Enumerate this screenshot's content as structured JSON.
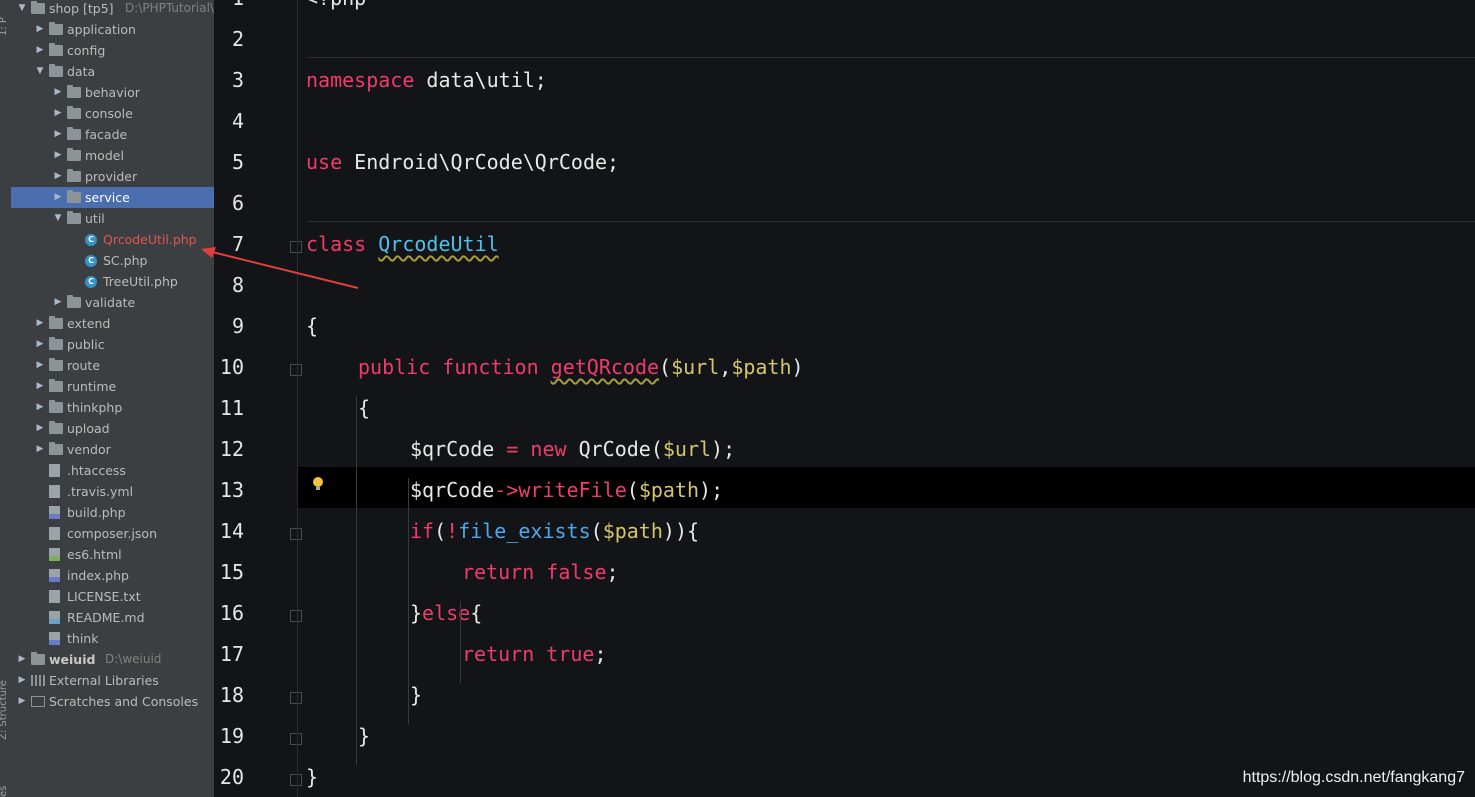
{
  "tool_strip": {
    "top_label": "1: P",
    "bottom_label": "Z: Structure",
    "bottom2_label": "es"
  },
  "tree": {
    "items": [
      {
        "label": "shop [tp5]",
        "hint": "D:\\PHPTutorial\\W",
        "indent": 0,
        "arrow": "down",
        "icon": "module"
      },
      {
        "label": "application",
        "indent": 1,
        "arrow": "right",
        "icon": "folder"
      },
      {
        "label": "config",
        "indent": 1,
        "arrow": "right",
        "icon": "folder"
      },
      {
        "label": "data",
        "indent": 1,
        "arrow": "down",
        "icon": "folder"
      },
      {
        "label": "behavior",
        "indent": 2,
        "arrow": "right",
        "icon": "folder"
      },
      {
        "label": "console",
        "indent": 2,
        "arrow": "right",
        "icon": "folder"
      },
      {
        "label": "facade",
        "indent": 2,
        "arrow": "right",
        "icon": "folder"
      },
      {
        "label": "model",
        "indent": 2,
        "arrow": "right",
        "icon": "folder"
      },
      {
        "label": "provider",
        "indent": 2,
        "arrow": "right",
        "icon": "folder"
      },
      {
        "label": "service",
        "indent": 2,
        "arrow": "right",
        "icon": "folder",
        "selected": true
      },
      {
        "label": "util",
        "indent": 2,
        "arrow": "down",
        "icon": "folder"
      },
      {
        "label": "QrcodeUtil.php",
        "indent": 3,
        "arrow": "",
        "icon": "class",
        "red": true
      },
      {
        "label": "SC.php",
        "indent": 3,
        "arrow": "",
        "icon": "class"
      },
      {
        "label": "TreeUtil.php",
        "indent": 3,
        "arrow": "",
        "icon": "class"
      },
      {
        "label": "validate",
        "indent": 2,
        "arrow": "right",
        "icon": "folder"
      },
      {
        "label": "extend",
        "indent": 1,
        "arrow": "right",
        "icon": "folder"
      },
      {
        "label": "public",
        "indent": 1,
        "arrow": "right",
        "icon": "folder"
      },
      {
        "label": "route",
        "indent": 1,
        "arrow": "right",
        "icon": "folder"
      },
      {
        "label": "runtime",
        "indent": 1,
        "arrow": "right",
        "icon": "folder"
      },
      {
        "label": "thinkphp",
        "indent": 1,
        "arrow": "right",
        "icon": "folder"
      },
      {
        "label": "upload",
        "indent": 1,
        "arrow": "right",
        "icon": "folder"
      },
      {
        "label": "vendor",
        "indent": 1,
        "arrow": "right",
        "icon": "folder"
      },
      {
        "label": ".htaccess",
        "indent": 1,
        "arrow": "",
        "icon": "file"
      },
      {
        "label": ".travis.yml",
        "indent": 1,
        "arrow": "",
        "icon": "file"
      },
      {
        "label": "build.php",
        "indent": 1,
        "arrow": "",
        "icon": "php"
      },
      {
        "label": "composer.json",
        "indent": 1,
        "arrow": "",
        "icon": "file"
      },
      {
        "label": "es6.html",
        "indent": 1,
        "arrow": "",
        "icon": "html"
      },
      {
        "label": "index.php",
        "indent": 1,
        "arrow": "",
        "icon": "php"
      },
      {
        "label": "LICENSE.txt",
        "indent": 1,
        "arrow": "",
        "icon": "file"
      },
      {
        "label": "README.md",
        "indent": 1,
        "arrow": "",
        "icon": "md"
      },
      {
        "label": "think",
        "indent": 1,
        "arrow": "",
        "icon": "php"
      },
      {
        "label": "weiuid",
        "hint": "D:\\weiuid",
        "indent": 0,
        "arrow": "right",
        "icon": "module",
        "bold": true
      },
      {
        "label": "External Libraries",
        "indent": 0,
        "arrow": "right",
        "icon": "lib"
      },
      {
        "label": "Scratches and Consoles",
        "indent": 0,
        "arrow": "right",
        "icon": "scratch"
      }
    ]
  },
  "editor": {
    "line_numbers": [
      "1",
      "2",
      "3",
      "4",
      "5",
      "6",
      "7",
      "8",
      "9",
      "10",
      "11",
      "12",
      "13",
      "14",
      "15",
      "16",
      "17",
      "18",
      "19",
      "20"
    ],
    "lines": [
      {
        "n": 1,
        "indent": 0,
        "tokens": [
          {
            "t": "<?php",
            "c": "txt"
          }
        ]
      },
      {
        "n": 2,
        "indent": 0,
        "tokens": []
      },
      {
        "n": 3,
        "indent": 0,
        "tokens": [
          {
            "t": "namespace",
            "c": "k"
          },
          {
            "t": " data\\util;",
            "c": "txt"
          }
        ]
      },
      {
        "n": 4,
        "indent": 0,
        "tokens": []
      },
      {
        "n": 5,
        "indent": 0,
        "tokens": [
          {
            "t": "use",
            "c": "k"
          },
          {
            "t": " Endroid\\QrCode\\QrCode;",
            "c": "txt"
          }
        ]
      },
      {
        "n": 6,
        "indent": 0,
        "tokens": []
      },
      {
        "n": 7,
        "indent": 0,
        "tokens": [
          {
            "t": "class",
            "c": "k"
          },
          {
            "t": " ",
            "c": "txt"
          },
          {
            "t": "QrcodeUtil",
            "c": "cls squig"
          }
        ]
      },
      {
        "n": 8,
        "indent": 0,
        "tokens": []
      },
      {
        "n": 9,
        "indent": 0,
        "tokens": [
          {
            "t": "{",
            "c": "txt"
          }
        ]
      },
      {
        "n": 10,
        "indent": 1,
        "tokens": [
          {
            "t": "public",
            "c": "k"
          },
          {
            "t": " ",
            "c": "txt"
          },
          {
            "t": "function",
            "c": "k"
          },
          {
            "t": " ",
            "c": "txt"
          },
          {
            "t": "getQRcode",
            "c": "fn squig"
          },
          {
            "t": "(",
            "c": "txt"
          },
          {
            "t": "$url",
            "c": "var"
          },
          {
            "t": ",",
            "c": "txt"
          },
          {
            "t": "$path",
            "c": "var"
          },
          {
            "t": ")",
            "c": "txt"
          }
        ]
      },
      {
        "n": 11,
        "indent": 1,
        "tokens": [
          {
            "t": "{",
            "c": "txt"
          }
        ]
      },
      {
        "n": 12,
        "indent": 2,
        "tokens": [
          {
            "t": "$qrCode",
            "c": "txt"
          },
          {
            "t": " = ",
            "c": "k"
          },
          {
            "t": "new",
            "c": "k"
          },
          {
            "t": " QrCode(",
            "c": "txt"
          },
          {
            "t": "$url",
            "c": "var"
          },
          {
            "t": ");",
            "c": "txt"
          }
        ]
      },
      {
        "n": 13,
        "indent": 2,
        "tokens": [
          {
            "t": "$qrCode",
            "c": "txt"
          },
          {
            "t": "->",
            "c": "k"
          },
          {
            "t": "writeFile",
            "c": "call"
          },
          {
            "t": "(",
            "c": "txt"
          },
          {
            "t": "$path",
            "c": "var"
          },
          {
            "t": ");",
            "c": "txt"
          }
        ]
      },
      {
        "n": 14,
        "indent": 2,
        "tokens": [
          {
            "t": "if",
            "c": "k"
          },
          {
            "t": "(",
            "c": "txt"
          },
          {
            "t": "!",
            "c": "k"
          },
          {
            "t": "file_exists",
            "c": "bfn"
          },
          {
            "t": "(",
            "c": "txt"
          },
          {
            "t": "$path",
            "c": "var"
          },
          {
            "t": ")){",
            "c": "txt"
          }
        ]
      },
      {
        "n": 15,
        "indent": 3,
        "tokens": [
          {
            "t": "return",
            "c": "k"
          },
          {
            "t": " ",
            "c": "txt"
          },
          {
            "t": "false",
            "c": "k"
          },
          {
            "t": ";",
            "c": "txt"
          }
        ]
      },
      {
        "n": 16,
        "indent": 2,
        "tokens": [
          {
            "t": "}",
            "c": "txt"
          },
          {
            "t": "else",
            "c": "k"
          },
          {
            "t": "{",
            "c": "txt"
          }
        ]
      },
      {
        "n": 17,
        "indent": 3,
        "tokens": [
          {
            "t": "return",
            "c": "k"
          },
          {
            "t": " ",
            "c": "txt"
          },
          {
            "t": "true",
            "c": "k"
          },
          {
            "t": ";",
            "c": "txt"
          }
        ]
      },
      {
        "n": 18,
        "indent": 2,
        "tokens": [
          {
            "t": "}",
            "c": "txt"
          }
        ]
      },
      {
        "n": 19,
        "indent": 1,
        "tokens": [
          {
            "t": "}",
            "c": "txt"
          }
        ]
      },
      {
        "n": 20,
        "indent": 0,
        "tokens": [
          {
            "t": "}",
            "c": "txt"
          }
        ]
      }
    ],
    "current_line": 13
  },
  "watermark": "https://blog.csdn.net/fangkang7",
  "colors": {
    "keyword": "#ee3c6b",
    "class": "#4fc1e9",
    "variable": "#d6c56e",
    "builtin": "#4fa8e8",
    "selection": "#4b6eaf",
    "annotation_arrow": "#e0403a"
  }
}
